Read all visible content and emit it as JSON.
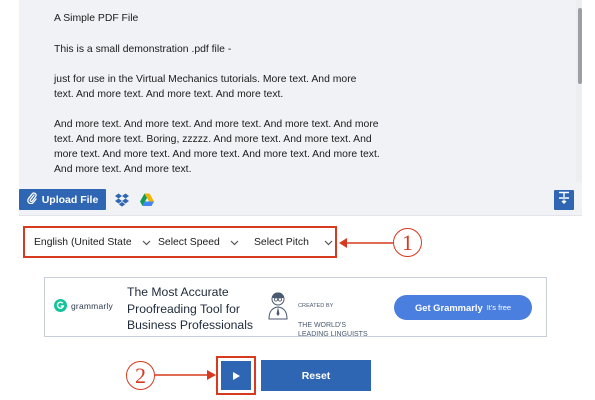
{
  "document": {
    "title": "A Simple PDF File",
    "text": "This is a small demonstration .pdf file -\n\njust for use in the Virtual Mechanics tutorials. More text. And more\ntext. And more text. And more text. And more text.\n\nAnd more text. And more text. And more text. And more text. And more\ntext. And more text. Boring, zzzzz. And more text. And more text. And\nmore text. And more text. And more text. And more text. And more text.\nAnd more text. And more text."
  },
  "toolbar": {
    "upload_label": "Upload File",
    "upload_icon": "paperclip-icon",
    "dropbox_icon": "dropbox-icon",
    "drive_icon": "google-drive-icon",
    "format_icon": "text-format-icon"
  },
  "controls": {
    "language": "English (United States)",
    "speed": "Select Speed",
    "pitch": "Select Pitch"
  },
  "callouts": {
    "one": "1",
    "two": "2"
  },
  "ad": {
    "brand": "grammarly",
    "headline": "The Most Accurate\nProofreading Tool for\nBusiness Professionals",
    "caption_small": "CREATED BY",
    "caption": "THE WORLD'S\nLEADING LINGUISTS",
    "cta": "Get Grammarly",
    "cta_sub": "It's free"
  },
  "player": {
    "play_icon": "play-icon",
    "reset_label": "Reset"
  },
  "colors": {
    "primary": "#2f66b3",
    "highlight": "#d63b1f",
    "ad_cta": "#4a7fe0",
    "grammarly": "#15c39a"
  }
}
